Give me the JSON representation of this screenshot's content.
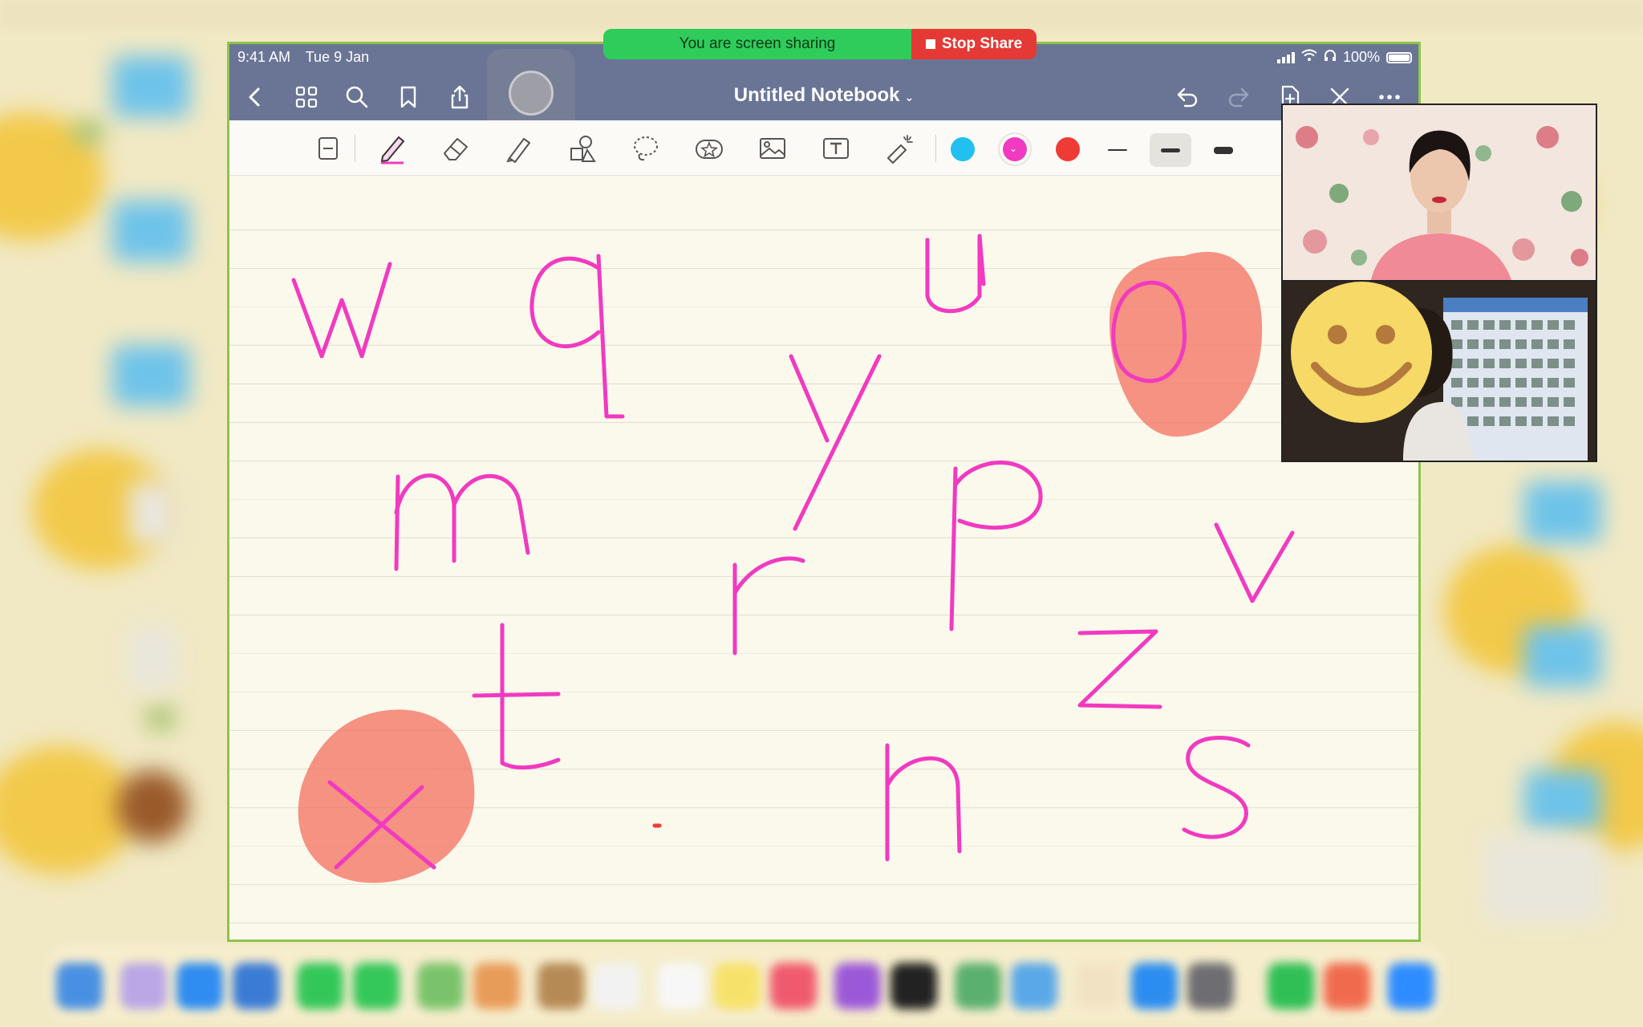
{
  "status": {
    "time": "9:41 AM",
    "date": "Tue 9 Jan",
    "battery": "100%"
  },
  "screen_share": {
    "message": "You are screen sharing",
    "stop_label": "Stop Share"
  },
  "notebook": {
    "title": "Untitled Notebook"
  },
  "colors": {
    "navbar": "#6a7596",
    "ink_pink": "#f13ac0",
    "highlight": "#f4705f",
    "share_green": "#2fcc5b",
    "stop_red": "#e53935"
  },
  "toolbar": {
    "tools": [
      "page-tool-icon",
      "pen-icon",
      "eraser-icon",
      "highlighter-icon",
      "shapes-icon",
      "lasso-icon",
      "sticker-icon",
      "image-icon",
      "text-icon",
      "laser-pointer-icon"
    ],
    "swatches": [
      "#21c0f0",
      "#f13ac0",
      "#ef3b35"
    ],
    "selected_swatch": 1,
    "selected_stroke": 1
  },
  "canvas": {
    "letters": [
      "w",
      "q",
      "u",
      "o",
      "y",
      "m",
      "p",
      "v",
      "r",
      "z",
      "t",
      "x",
      "n",
      "s"
    ]
  }
}
